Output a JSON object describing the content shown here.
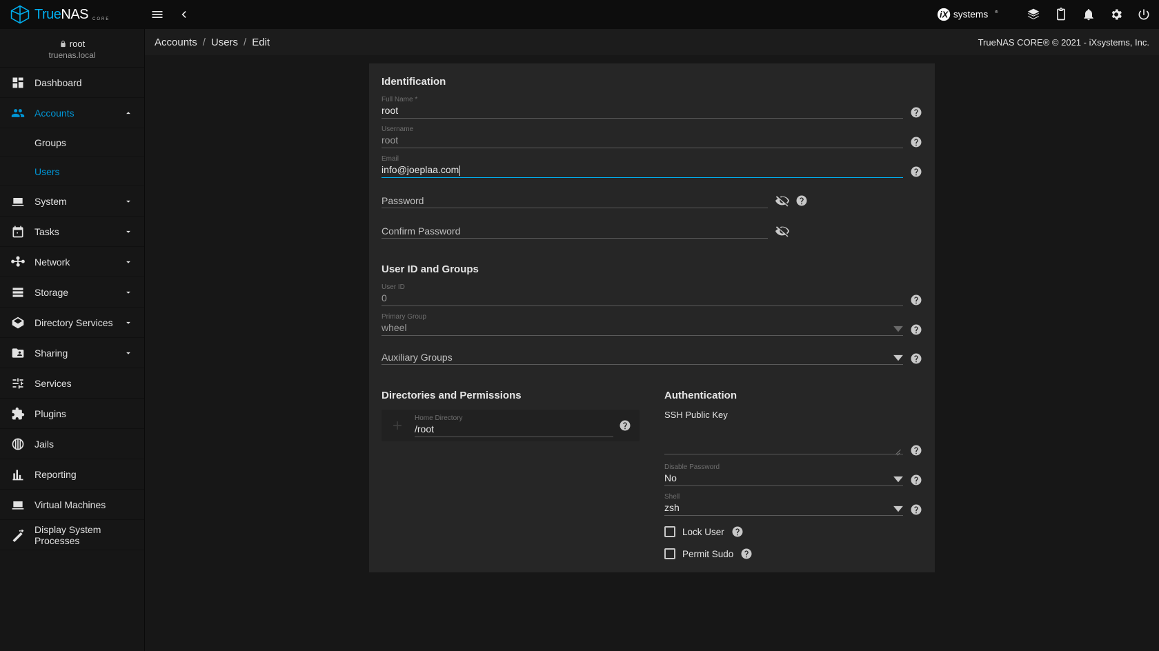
{
  "brand": {
    "true": "True",
    "nas": "NAS",
    "core": "CORE"
  },
  "topbar": {
    "ix": "systems"
  },
  "breadcrumb": {
    "a": "Accounts",
    "b": "Users",
    "c": "Edit"
  },
  "footer_copy": "TrueNAS CORE® © 2021 - iXsystems, Inc.",
  "sb_header": {
    "user": "root",
    "host": "truenas.local"
  },
  "nav": {
    "dashboard": "Dashboard",
    "accounts": "Accounts",
    "groups": "Groups",
    "users": "Users",
    "system": "System",
    "tasks": "Tasks",
    "network": "Network",
    "storage": "Storage",
    "dirsvc": "Directory Services",
    "sharing": "Sharing",
    "services": "Services",
    "plugins": "Plugins",
    "jails": "Jails",
    "reporting": "Reporting",
    "vms": "Virtual Machines",
    "dsp": "Display System Processes"
  },
  "form": {
    "sec_identification": "Identification",
    "full_name_label": "Full Name *",
    "full_name": "root",
    "username_label": "Username",
    "username": "root",
    "email_label": "Email",
    "email": "info@joeplaa.com",
    "password_ph": "Password",
    "confirm_pw_ph": "Confirm Password",
    "sec_uidgroups": "User ID and Groups",
    "uid_label": "User ID",
    "uid": "0",
    "pgroup_label": "Primary Group",
    "pgroup": "wheel",
    "aux_groups_ph": "Auxiliary Groups",
    "sec_dirperm": "Directories and Permissions",
    "home_dir_label": "Home Directory",
    "home_dir": "/root",
    "sec_auth": "Authentication",
    "ssh_label": "SSH Public Key",
    "disable_pw_label": "Disable Password",
    "disable_pw": "No",
    "shell_label": "Shell",
    "shell": "zsh",
    "lock_user": "Lock User",
    "permit_sudo": "Permit Sudo"
  }
}
